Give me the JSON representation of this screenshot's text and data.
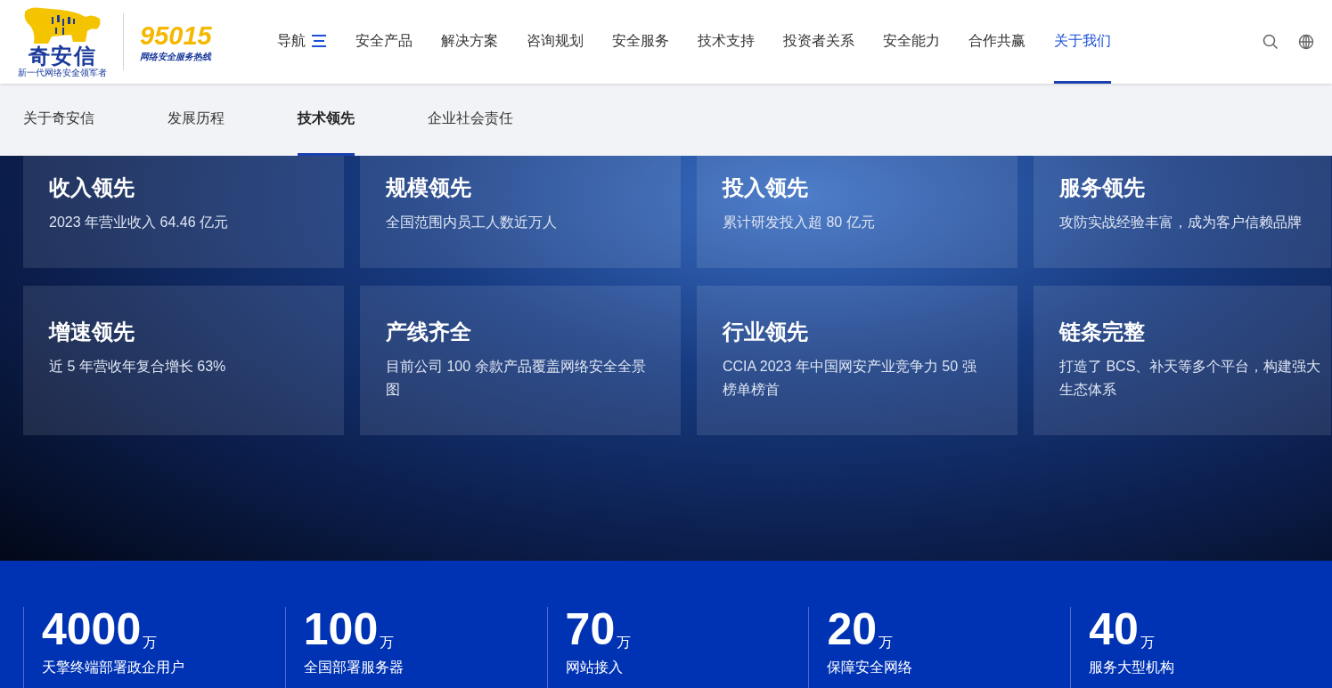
{
  "logo": {
    "name": "奇安信",
    "slogan": "新一代网络安全领军者"
  },
  "hotline": {
    "number": "95015",
    "label": "网络安全服务热线"
  },
  "nav": [
    {
      "label": "导航",
      "kind": "menu",
      "selected": false
    },
    {
      "label": "安全产品",
      "kind": "link",
      "selected": false
    },
    {
      "label": "解决方案",
      "kind": "link",
      "selected": false
    },
    {
      "label": "咨询规划",
      "kind": "link",
      "selected": false
    },
    {
      "label": "安全服务",
      "kind": "link",
      "selected": false
    },
    {
      "label": "技术支持",
      "kind": "link",
      "selected": false
    },
    {
      "label": "投资者关系",
      "kind": "link",
      "selected": false
    },
    {
      "label": "安全能力",
      "kind": "link",
      "selected": false
    },
    {
      "label": "合作共赢",
      "kind": "link",
      "selected": false
    },
    {
      "label": "关于我们",
      "kind": "link",
      "selected": true
    }
  ],
  "subnav": [
    {
      "label": "关于奇安信",
      "selected": false
    },
    {
      "label": "发展历程",
      "selected": false
    },
    {
      "label": "技术领先",
      "selected": true
    },
    {
      "label": "企业社会责任",
      "selected": false
    }
  ],
  "cards": [
    {
      "title": "收入领先",
      "text": "2023 年营业收入 64.46 亿元"
    },
    {
      "title": "规模领先",
      "text": "全国范围内员工人数近万人"
    },
    {
      "title": "投入领先",
      "text": "累计研发投入超 80 亿元"
    },
    {
      "title": "服务领先",
      "text": "攻防实战经验丰富，成为客户信赖品牌"
    },
    {
      "title": "增速领先",
      "text": "近 5 年营收年复合增长 63%"
    },
    {
      "title": "产线齐全",
      "text": "目前公司 100 余款产品覆盖网络安全全景图"
    },
    {
      "title": "行业领先",
      "text": "CCIA 2023 年中国网安产业竞争力 50 强榜单榜首"
    },
    {
      "title": "链条完整",
      "text": "打造了 BCS、补天等多个平台，构建强大生态体系"
    }
  ],
  "stats": [
    {
      "value": "4000",
      "unit": "万",
      "label": "天擎终端部署政企用户"
    },
    {
      "value": "100",
      "unit": "万",
      "label": "全国部署服务器"
    },
    {
      "value": "70",
      "unit": "万",
      "label": "网站接入"
    },
    {
      "value": "20",
      "unit": "万",
      "label": "保障安全网络"
    },
    {
      "value": "40",
      "unit": "万",
      "label": "服务大型机构"
    }
  ]
}
